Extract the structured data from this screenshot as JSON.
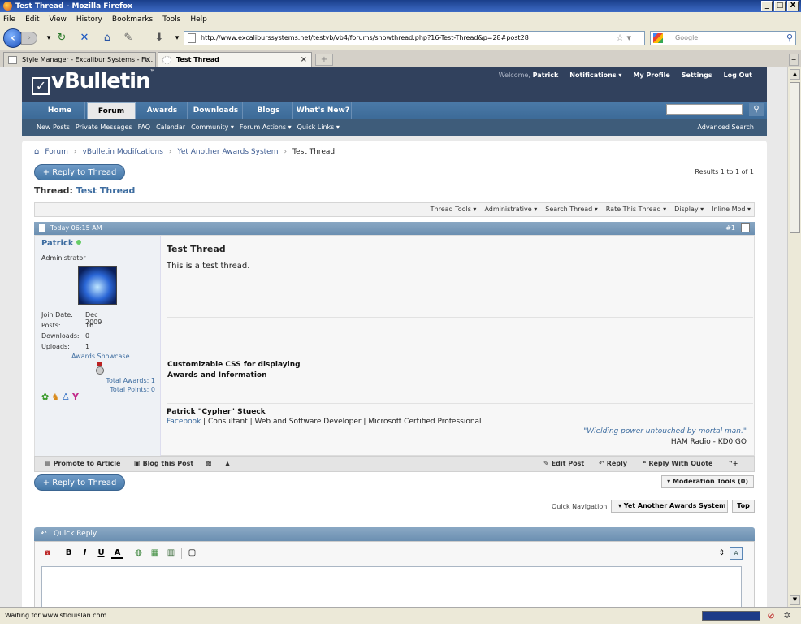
{
  "window": {
    "title": "Test Thread - Mozilla Firefox",
    "min": "_",
    "max": "□",
    "close": "X"
  },
  "menu": [
    "File",
    "Edit",
    "View",
    "History",
    "Bookmarks",
    "Tools",
    "Help"
  ],
  "nav": {
    "url": "http://www.excaliburssystems.net/testvb/vb4/forums/showthread.php?16-Test-Thread&p=28#post28",
    "search_placeholder": "Google"
  },
  "tabs": [
    {
      "label": "Style Manager - Excalibur Systems - Fo...",
      "close": "×"
    },
    {
      "label": "Test Thread",
      "close": "×"
    }
  ],
  "tab_new": "+",
  "status": {
    "text": "Waiting for www.stlouislan.com..."
  },
  "header": {
    "logo": "vBulletin",
    "logo_tm": "™",
    "welcome": "Welcome,",
    "user": "Patrick",
    "notifications": "Notifications ▾",
    "my_profile": "My Profile",
    "settings": "Settings",
    "logout": "Log Out",
    "tabs": [
      "Home",
      "Forum",
      "Awards",
      "Downloads",
      "Blogs",
      "What's New?"
    ],
    "subnav": [
      "New Posts",
      "Private Messages",
      "FAQ",
      "Calendar",
      "Community ▾",
      "Forum Actions ▾",
      "Quick Links ▾"
    ],
    "advanced_search": "Advanced Search"
  },
  "breadcrumb": [
    "Forum",
    "vBulletin Modifcations",
    "Yet Another Awards System",
    "Test Thread"
  ],
  "reply_to_thread": "+ Reply to Thread",
  "results": "Results 1 to 1 of 1",
  "thread": {
    "label": "Thread:",
    "title": "Test Thread"
  },
  "tools": [
    "Thread Tools ▾",
    "Administrative ▾",
    "Search Thread ▾",
    "Rate This Thread ▾",
    "Display ▾",
    "Inline Mod ▾"
  ],
  "post": {
    "date": "Today 06:15 AM",
    "number": "#1",
    "username": "Patrick",
    "usertitle": "Administrator",
    "stats": [
      {
        "label": "Join Date:",
        "value": "Dec 2009"
      },
      {
        "label": "Posts:",
        "value": "16"
      },
      {
        "label": "Downloads:",
        "value": "0"
      },
      {
        "label": "Uploads:",
        "value": "1"
      }
    ],
    "awards_showcase": "Awards Showcase",
    "total_awards": "Total Awards: 1",
    "total_points": "Total Points: 0",
    "title": "Test Thread",
    "text": "This is a test thread.",
    "css_note_line1": "Customizable CSS for displaying",
    "css_note_line2": "Awards and Information",
    "sig_name": "Patrick \"Cypher\" Stueck",
    "sig_facebook": "Facebook",
    "sig_rest": " | Consultant | Web and Software Developer | Microsoft Certified Professional",
    "sig_quote": "\"Wielding power untouched by mortal man.\"",
    "sig_ham": "HAM Radio - KD0IGO"
  },
  "post_actions": {
    "promote": "Promote to Article",
    "blog": "Blog this Post",
    "edit": "Edit Post",
    "reply": "Reply",
    "reply_quote": "Reply With Quote"
  },
  "moderation_tools": "▾ Moderation Tools (0)",
  "quick_nav": {
    "label": "Quick Navigation",
    "selected": "▾ Yet Another Awards System",
    "top": "Top"
  },
  "quick_reply": "Quick Reply",
  "editor": {
    "bold": "B",
    "italic": "I",
    "underline": "U",
    "color": "A"
  }
}
